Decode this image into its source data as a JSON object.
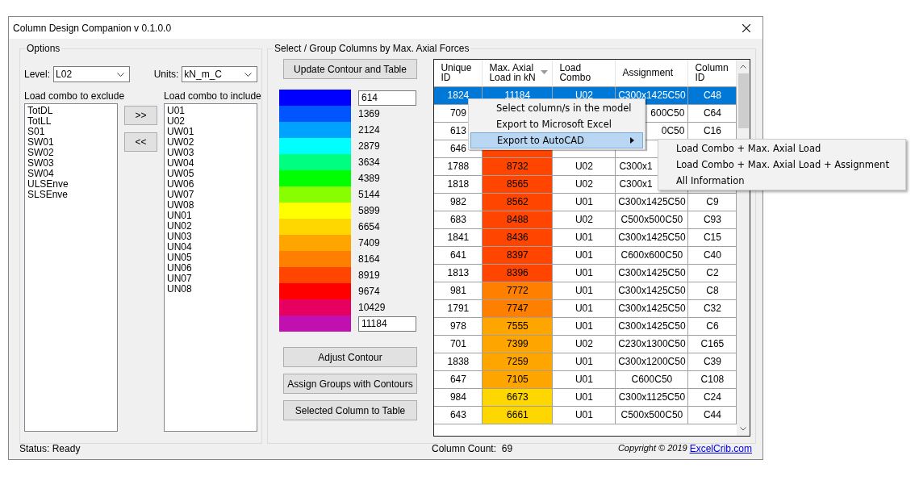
{
  "window": {
    "title": "Column Design Companion v 0.1.0.0"
  },
  "options": {
    "title": "Options",
    "level": {
      "label": "Level:",
      "value": "L02"
    },
    "units": {
      "label": "Units:",
      "value": "kN_m_C"
    },
    "exclude": {
      "label": "Load combo to exclude",
      "items": [
        "TotDL",
        "TotLL",
        "S01",
        "SW01",
        "SW02",
        "SW03",
        "SW04",
        "ULSEnve",
        "SLSEnve"
      ]
    },
    "include": {
      "label": "Load combo to include",
      "items": [
        "U01",
        "U02",
        "UW01",
        "UW02",
        "UW03",
        "UW04",
        "UW05",
        "UW06",
        "UW07",
        "UW08",
        "UN01",
        "UN02",
        "UN03",
        "UN04",
        "UN05",
        "UN06",
        "UN07",
        "UN08"
      ]
    },
    "move_buttons": [
      ">>",
      "<<"
    ]
  },
  "select_panel": {
    "title": "Select / Group Columns by Max. Axial Forces",
    "update_button": "Update Contour and Table",
    "contour": [
      {
        "color": "#0000ff",
        "value": "614",
        "kind": "input"
      },
      {
        "color": "#0055ff",
        "value": "1369",
        "kind": "label"
      },
      {
        "color": "#00a2ff",
        "value": "2124",
        "kind": "label"
      },
      {
        "color": "#00ffff",
        "value": "2879",
        "kind": "label"
      },
      {
        "color": "#00ff80",
        "value": "3634",
        "kind": "label"
      },
      {
        "color": "#00ff00",
        "value": "4389",
        "kind": "label"
      },
      {
        "color": "#88ff00",
        "value": "5144",
        "kind": "label"
      },
      {
        "color": "#ffff00",
        "value": "5899",
        "kind": "label"
      },
      {
        "color": "#ffd700",
        "value": "6654",
        "kind": "label"
      },
      {
        "color": "#ffa500",
        "value": "7409",
        "kind": "label"
      },
      {
        "color": "#ff8000",
        "value": "8164",
        "kind": "label"
      },
      {
        "color": "#ff4500",
        "value": "8919",
        "kind": "label"
      },
      {
        "color": "#ff0000",
        "value": "9674",
        "kind": "label"
      },
      {
        "color": "#e80060",
        "value": "10429",
        "kind": "label"
      },
      {
        "color": "#c010b0",
        "value": "11184",
        "kind": "input"
      }
    ],
    "buttons": [
      "Adjust Contour",
      "Assign Groups with Contours",
      "Selected Column to Table"
    ]
  },
  "table": {
    "columns": [
      "Unique ID",
      "Max. Axial Load in kN",
      "Load Combo",
      "Assignment",
      "Column ID"
    ],
    "rows": [
      {
        "selected": true,
        "unique_id": "1824",
        "max_axial_load": "11184",
        "load_combo": "U02",
        "assignment": "C300x1425C50",
        "column_id": "C48"
      },
      {
        "selected": false,
        "unique_id": "709",
        "assignment": "600C50",
        "column_id": "C64"
      },
      {
        "selected": false,
        "unique_id": "613",
        "assignment": "0C50",
        "column_id": "C16"
      },
      {
        "selected": false,
        "unique_id": "646",
        "color": "#ff4500"
      },
      {
        "selected": false,
        "unique_id": "1788",
        "max_axial_load": "8732",
        "load_combo": "U02",
        "assignment": "C300x1",
        "color": "#ff4500"
      },
      {
        "selected": false,
        "unique_id": "1818",
        "max_axial_load": "8565",
        "load_combo": "U02",
        "assignment": "C300x1",
        "color": "#ff4500"
      },
      {
        "selected": false,
        "unique_id": "982",
        "max_axial_load": "8562",
        "load_combo": "U01",
        "assignment": "C300x1425C50",
        "column_id": "C9",
        "color": "#ff4500"
      },
      {
        "selected": false,
        "unique_id": "683",
        "max_axial_load": "8488",
        "load_combo": "U02",
        "assignment": "C500x500C50",
        "column_id": "C93",
        "color": "#ff4500"
      },
      {
        "selected": false,
        "unique_id": "1841",
        "max_axial_load": "8436",
        "load_combo": "U01",
        "assignment": "C300x1425C50",
        "column_id": "C15",
        "color": "#ff4500"
      },
      {
        "selected": false,
        "unique_id": "641",
        "max_axial_load": "8397",
        "load_combo": "U01",
        "assignment": "C600x600C50",
        "column_id": "C40",
        "color": "#ff4500"
      },
      {
        "selected": false,
        "unique_id": "1813",
        "max_axial_load": "8396",
        "load_combo": "U01",
        "assignment": "C300x1425C50",
        "column_id": "C2",
        "color": "#ff4500"
      },
      {
        "selected": false,
        "unique_id": "981",
        "max_axial_load": "7772",
        "load_combo": "U01",
        "assignment": "C300x1425C50",
        "column_id": "C8",
        "color": "#ff8000"
      },
      {
        "selected": false,
        "unique_id": "1791",
        "max_axial_load": "7747",
        "load_combo": "U01",
        "assignment": "C300x1425C50",
        "column_id": "C32",
        "color": "#ff8000"
      },
      {
        "selected": false,
        "unique_id": "978",
        "max_axial_load": "7555",
        "load_combo": "U01",
        "assignment": "C300x1425C50",
        "column_id": "C6",
        "color": "#ffa500"
      },
      {
        "selected": false,
        "unique_id": "701",
        "max_axial_load": "7399",
        "load_combo": "U02",
        "assignment": "C230x1300C50",
        "column_id": "C165",
        "color": "#ffa500"
      },
      {
        "selected": false,
        "unique_id": "1838",
        "max_axial_load": "7259",
        "load_combo": "U01",
        "assignment": "C300x1200C50",
        "column_id": "C39",
        "color": "#ffa500"
      },
      {
        "selected": false,
        "unique_id": "647",
        "max_axial_load": "7105",
        "load_combo": "U01",
        "assignment": "C600C50",
        "column_id": "C108",
        "color": "#ffa500"
      },
      {
        "selected": false,
        "unique_id": "984",
        "max_axial_load": "6673",
        "load_combo": "U01",
        "assignment": "C300x1125C50",
        "column_id": "C24",
        "color": "#ffd700"
      },
      {
        "selected": false,
        "unique_id": "643",
        "max_axial_load": "6661",
        "load_combo": "U01",
        "assignment": "C500x500C50",
        "column_id": "C44",
        "color": "#ffd700"
      }
    ]
  },
  "context_menu": {
    "items": [
      {
        "label": "Select column/s in the model",
        "highlighted": false,
        "submenu": false
      },
      {
        "label": "Export to Microsoft Excel",
        "highlighted": false,
        "submenu": false
      },
      {
        "label": "Export to AutoCAD",
        "highlighted": true,
        "submenu": true
      }
    ],
    "submenu": [
      "Load Combo + Max. Axial Load",
      "Load Combo + Max. Axial Load + Assignment",
      "All Information"
    ]
  },
  "status_bar": {
    "status": "Status: Ready",
    "count": "Column Count:  69",
    "copyright": "Copyright © 2019",
    "link": "ExcelCrib.com"
  }
}
